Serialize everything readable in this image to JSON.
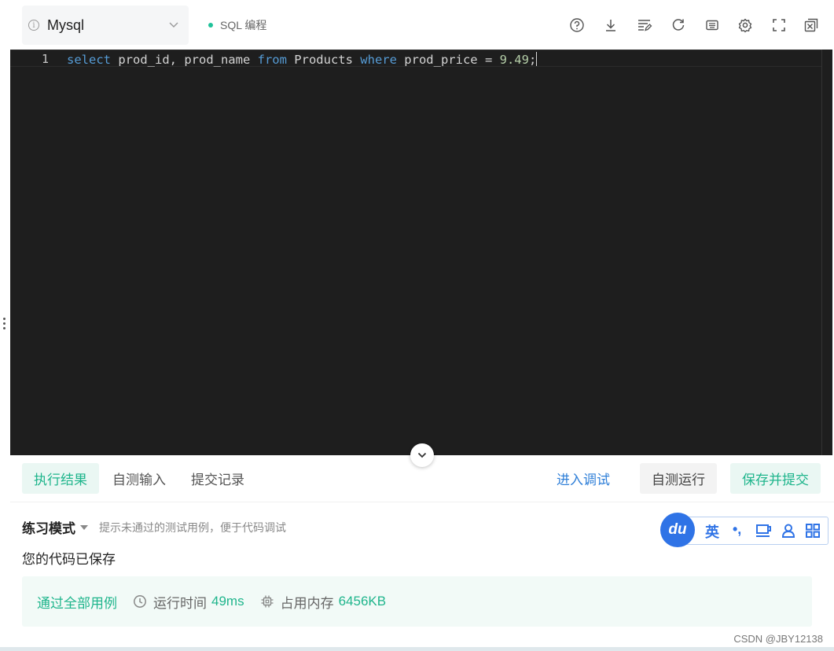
{
  "toolbar": {
    "language": "Mysql",
    "mode_label": "SQL 编程",
    "tools": [
      "help-icon",
      "download-icon",
      "format-icon",
      "refresh-icon",
      "keyboard-icon",
      "settings-icon",
      "fullscreen-icon",
      "close-window-icon"
    ]
  },
  "editor": {
    "line_number": "1",
    "tokens": {
      "t1": "select",
      "t2": " prod_id, prod_name ",
      "t3": "from",
      "t4": " Products ",
      "t5": "where",
      "t6": " prod_price = ",
      "t7": "9.49",
      "t8": ";"
    }
  },
  "result_tabs": {
    "exec_result": "执行结果",
    "self_test_input": "自测输入",
    "submit_records": "提交记录"
  },
  "actions": {
    "debug": "进入调试",
    "self_run": "自测运行",
    "save_submit": "保存并提交"
  },
  "practice": {
    "title": "练习模式",
    "hint": "提示未通过的测试用例，便于代码调试",
    "saved_msg": "您的代码已保存"
  },
  "result": {
    "pass_text": "通过全部用例",
    "runtime_label": "运行时间",
    "runtime_value": "49ms",
    "memory_label": "占用内存",
    "memory_value": "6456KB"
  },
  "ime": {
    "logo": "du",
    "lang": "英",
    "punct": "•,"
  },
  "watermark": "CSDN @JBY12138",
  "colors": {
    "accent_green": "#1fb58c",
    "link_blue": "#2f7fd8",
    "editor_bg": "#1e1e1e",
    "keyword_blue": "#569cd6"
  }
}
